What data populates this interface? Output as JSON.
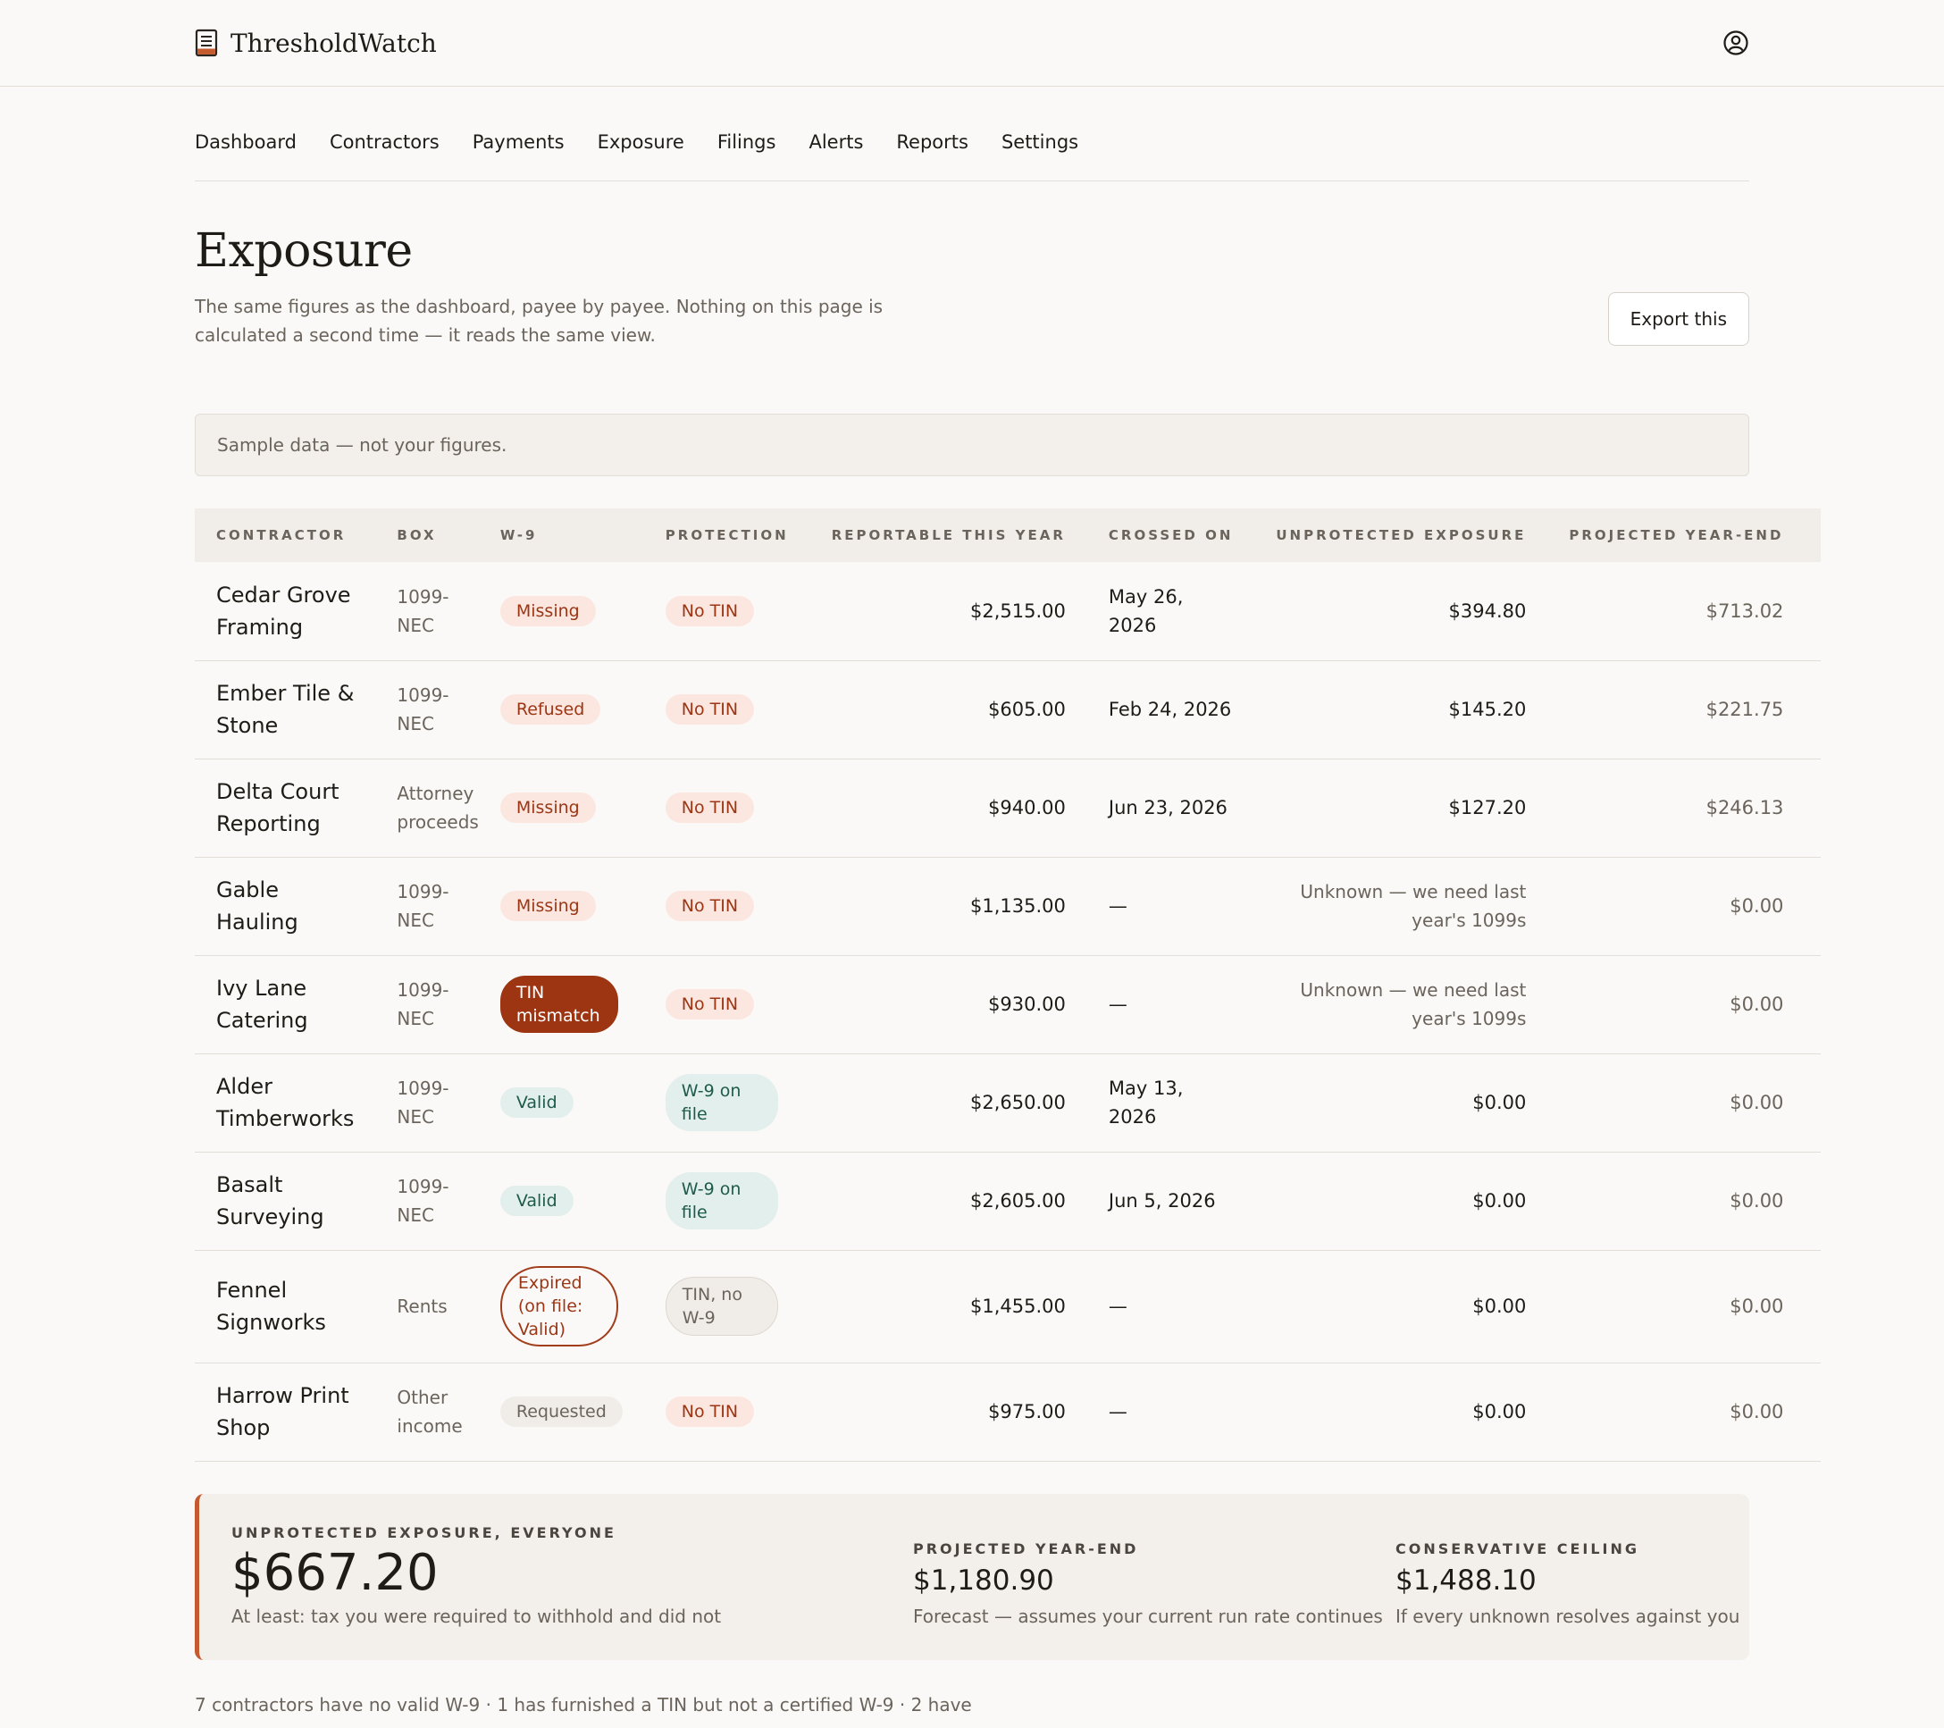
{
  "app": {
    "name": "ThresholdWatch"
  },
  "icons": {
    "logo": "ledger-icon",
    "user": "user-circle-icon"
  },
  "colors": {
    "accent": "#c45a2e",
    "danger": "#9d3513",
    "ok": "#1e5b4c"
  },
  "nav": [
    "Dashboard",
    "Contractors",
    "Payments",
    "Exposure",
    "Filings",
    "Alerts",
    "Reports",
    "Settings"
  ],
  "page": {
    "title": "Exposure",
    "subtitle": "The same figures as the dashboard, payee by payee. Nothing on this page is calculated a second time — it reads the same view.",
    "export_label": "Export this",
    "banner": "Sample data — not your figures."
  },
  "table": {
    "headers": [
      "CONTRACTOR",
      "BOX",
      "W-9",
      "PROTECTION",
      "REPORTABLE THIS YEAR",
      "CROSSED ON",
      "UNPROTECTED EXPOSURE",
      "PROJECTED YEAR-END"
    ],
    "rows": [
      {
        "contractor": "Cedar Grove Framing",
        "box": "1099-NEC",
        "w9": "Missing",
        "protection": "No TIN",
        "reportable": "$2,515.00",
        "crossed": "May 26, 2026",
        "exposure": "$394.80",
        "projected": "$713.02"
      },
      {
        "contractor": "Ember Tile & Stone",
        "box": "1099-NEC",
        "w9": "Refused",
        "protection": "No TIN",
        "reportable": "$605.00",
        "crossed": "Feb 24, 2026",
        "exposure": "$145.20",
        "projected": "$221.75"
      },
      {
        "contractor": "Delta Court Reporting",
        "box": "Attorney proceeds",
        "w9": "Missing",
        "protection": "No TIN",
        "reportable": "$940.00",
        "crossed": "Jun 23, 2026",
        "exposure": "$127.20",
        "projected": "$246.13"
      },
      {
        "contractor": "Gable Hauling",
        "box": "1099-NEC",
        "w9": "Missing",
        "protection": "No TIN",
        "reportable": "$1,135.00",
        "crossed": "—",
        "exposure": "Unknown — we need last year's 1099s",
        "projected": "$0.00"
      },
      {
        "contractor": "Ivy Lane Catering",
        "box": "1099-NEC",
        "w9": "TIN mismatch",
        "protection": "No TIN",
        "reportable": "$930.00",
        "crossed": "—",
        "exposure": "Unknown — we need last year's 1099s",
        "projected": "$0.00"
      },
      {
        "contractor": "Alder Timberworks",
        "box": "1099-NEC",
        "w9": "Valid",
        "protection": "W-9 on file",
        "reportable": "$2,650.00",
        "crossed": "May 13, 2026",
        "exposure": "$0.00",
        "projected": "$0.00"
      },
      {
        "contractor": "Basalt Surveying",
        "box": "1099-NEC",
        "w9": "Valid",
        "protection": "W-9 on file",
        "reportable": "$2,605.00",
        "crossed": "Jun 5, 2026",
        "exposure": "$0.00",
        "projected": "$0.00"
      },
      {
        "contractor": "Fennel Signworks",
        "box": "Rents",
        "w9": "Expired (on file: Valid)",
        "protection": "TIN, no W-9",
        "reportable": "$1,455.00",
        "crossed": "—",
        "exposure": "$0.00",
        "projected": "$0.00"
      },
      {
        "contractor": "Harrow Print Shop",
        "box": "Other income",
        "w9": "Requested",
        "protection": "No TIN",
        "reportable": "$975.00",
        "crossed": "—",
        "exposure": "$0.00",
        "projected": "$0.00"
      }
    ]
  },
  "summary": {
    "main": {
      "label": "UNPROTECTED EXPOSURE, EVERYONE",
      "value": "$667.20",
      "note": "At least: tax you were required to withhold and did not"
    },
    "projected": {
      "label": "PROJECTED YEAR-END",
      "value": "$1,180.90",
      "note": "Forecast — assumes your current run rate continues"
    },
    "ceiling": {
      "label": "CONSERVATIVE CEILING",
      "value": "$1,488.10",
      "note": "If every unknown resolves against you"
    }
  },
  "footer_note": "7 contractors have no valid W-9 · 1 has furnished a TIN but not a certified W-9 · 2 have"
}
